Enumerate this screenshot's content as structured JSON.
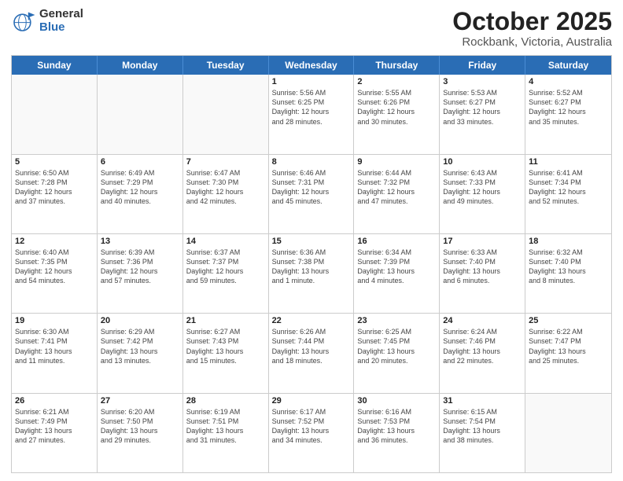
{
  "logo": {
    "general": "General",
    "blue": "Blue"
  },
  "header": {
    "month": "October 2025",
    "location": "Rockbank, Victoria, Australia"
  },
  "weekdays": [
    "Sunday",
    "Monday",
    "Tuesday",
    "Wednesday",
    "Thursday",
    "Friday",
    "Saturday"
  ],
  "rows": [
    [
      {
        "day": "",
        "info": "",
        "empty": true
      },
      {
        "day": "",
        "info": "",
        "empty": true
      },
      {
        "day": "",
        "info": "",
        "empty": true
      },
      {
        "day": "1",
        "info": "Sunrise: 5:56 AM\nSunset: 6:25 PM\nDaylight: 12 hours\nand 28 minutes."
      },
      {
        "day": "2",
        "info": "Sunrise: 5:55 AM\nSunset: 6:26 PM\nDaylight: 12 hours\nand 30 minutes."
      },
      {
        "day": "3",
        "info": "Sunrise: 5:53 AM\nSunset: 6:27 PM\nDaylight: 12 hours\nand 33 minutes."
      },
      {
        "day": "4",
        "info": "Sunrise: 5:52 AM\nSunset: 6:27 PM\nDaylight: 12 hours\nand 35 minutes."
      }
    ],
    [
      {
        "day": "5",
        "info": "Sunrise: 6:50 AM\nSunset: 7:28 PM\nDaylight: 12 hours\nand 37 minutes."
      },
      {
        "day": "6",
        "info": "Sunrise: 6:49 AM\nSunset: 7:29 PM\nDaylight: 12 hours\nand 40 minutes."
      },
      {
        "day": "7",
        "info": "Sunrise: 6:47 AM\nSunset: 7:30 PM\nDaylight: 12 hours\nand 42 minutes."
      },
      {
        "day": "8",
        "info": "Sunrise: 6:46 AM\nSunset: 7:31 PM\nDaylight: 12 hours\nand 45 minutes."
      },
      {
        "day": "9",
        "info": "Sunrise: 6:44 AM\nSunset: 7:32 PM\nDaylight: 12 hours\nand 47 minutes."
      },
      {
        "day": "10",
        "info": "Sunrise: 6:43 AM\nSunset: 7:33 PM\nDaylight: 12 hours\nand 49 minutes."
      },
      {
        "day": "11",
        "info": "Sunrise: 6:41 AM\nSunset: 7:34 PM\nDaylight: 12 hours\nand 52 minutes."
      }
    ],
    [
      {
        "day": "12",
        "info": "Sunrise: 6:40 AM\nSunset: 7:35 PM\nDaylight: 12 hours\nand 54 minutes."
      },
      {
        "day": "13",
        "info": "Sunrise: 6:39 AM\nSunset: 7:36 PM\nDaylight: 12 hours\nand 57 minutes."
      },
      {
        "day": "14",
        "info": "Sunrise: 6:37 AM\nSunset: 7:37 PM\nDaylight: 12 hours\nand 59 minutes."
      },
      {
        "day": "15",
        "info": "Sunrise: 6:36 AM\nSunset: 7:38 PM\nDaylight: 13 hours\nand 1 minute."
      },
      {
        "day": "16",
        "info": "Sunrise: 6:34 AM\nSunset: 7:39 PM\nDaylight: 13 hours\nand 4 minutes."
      },
      {
        "day": "17",
        "info": "Sunrise: 6:33 AM\nSunset: 7:40 PM\nDaylight: 13 hours\nand 6 minutes."
      },
      {
        "day": "18",
        "info": "Sunrise: 6:32 AM\nSunset: 7:40 PM\nDaylight: 13 hours\nand 8 minutes."
      }
    ],
    [
      {
        "day": "19",
        "info": "Sunrise: 6:30 AM\nSunset: 7:41 PM\nDaylight: 13 hours\nand 11 minutes."
      },
      {
        "day": "20",
        "info": "Sunrise: 6:29 AM\nSunset: 7:42 PM\nDaylight: 13 hours\nand 13 minutes."
      },
      {
        "day": "21",
        "info": "Sunrise: 6:27 AM\nSunset: 7:43 PM\nDaylight: 13 hours\nand 15 minutes."
      },
      {
        "day": "22",
        "info": "Sunrise: 6:26 AM\nSunset: 7:44 PM\nDaylight: 13 hours\nand 18 minutes."
      },
      {
        "day": "23",
        "info": "Sunrise: 6:25 AM\nSunset: 7:45 PM\nDaylight: 13 hours\nand 20 minutes."
      },
      {
        "day": "24",
        "info": "Sunrise: 6:24 AM\nSunset: 7:46 PM\nDaylight: 13 hours\nand 22 minutes."
      },
      {
        "day": "25",
        "info": "Sunrise: 6:22 AM\nSunset: 7:47 PM\nDaylight: 13 hours\nand 25 minutes."
      }
    ],
    [
      {
        "day": "26",
        "info": "Sunrise: 6:21 AM\nSunset: 7:49 PM\nDaylight: 13 hours\nand 27 minutes."
      },
      {
        "day": "27",
        "info": "Sunrise: 6:20 AM\nSunset: 7:50 PM\nDaylight: 13 hours\nand 29 minutes."
      },
      {
        "day": "28",
        "info": "Sunrise: 6:19 AM\nSunset: 7:51 PM\nDaylight: 13 hours\nand 31 minutes."
      },
      {
        "day": "29",
        "info": "Sunrise: 6:17 AM\nSunset: 7:52 PM\nDaylight: 13 hours\nand 34 minutes."
      },
      {
        "day": "30",
        "info": "Sunrise: 6:16 AM\nSunset: 7:53 PM\nDaylight: 13 hours\nand 36 minutes."
      },
      {
        "day": "31",
        "info": "Sunrise: 6:15 AM\nSunset: 7:54 PM\nDaylight: 13 hours\nand 38 minutes."
      },
      {
        "day": "",
        "info": "",
        "empty": true
      }
    ]
  ]
}
